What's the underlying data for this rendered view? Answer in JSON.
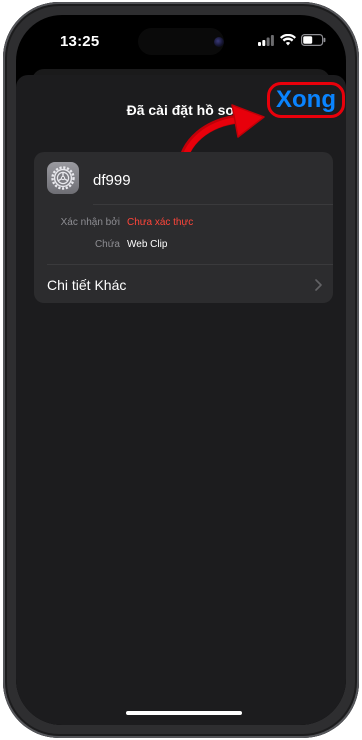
{
  "status_bar": {
    "time": "13:25"
  },
  "sheet": {
    "title": "Đã cài đặt hồ sơ",
    "done_label": "Xong"
  },
  "profile": {
    "name": "df999",
    "icon": "settings-gear-icon",
    "details": [
      {
        "label": "Xác nhận bởi",
        "value": "Chưa xác thực",
        "value_color": "#ff453a"
      },
      {
        "label": "Chứa",
        "value": "Web Clip",
        "value_color": "#ffffff"
      }
    ],
    "more_details_label": "Chi tiết Khác"
  },
  "colors": {
    "accent": "#0a84ff",
    "warning": "#ff453a",
    "annotation_red": "#e8000b",
    "sheet_background": "#1c1c1e",
    "card_background": "#2c2c2e"
  }
}
